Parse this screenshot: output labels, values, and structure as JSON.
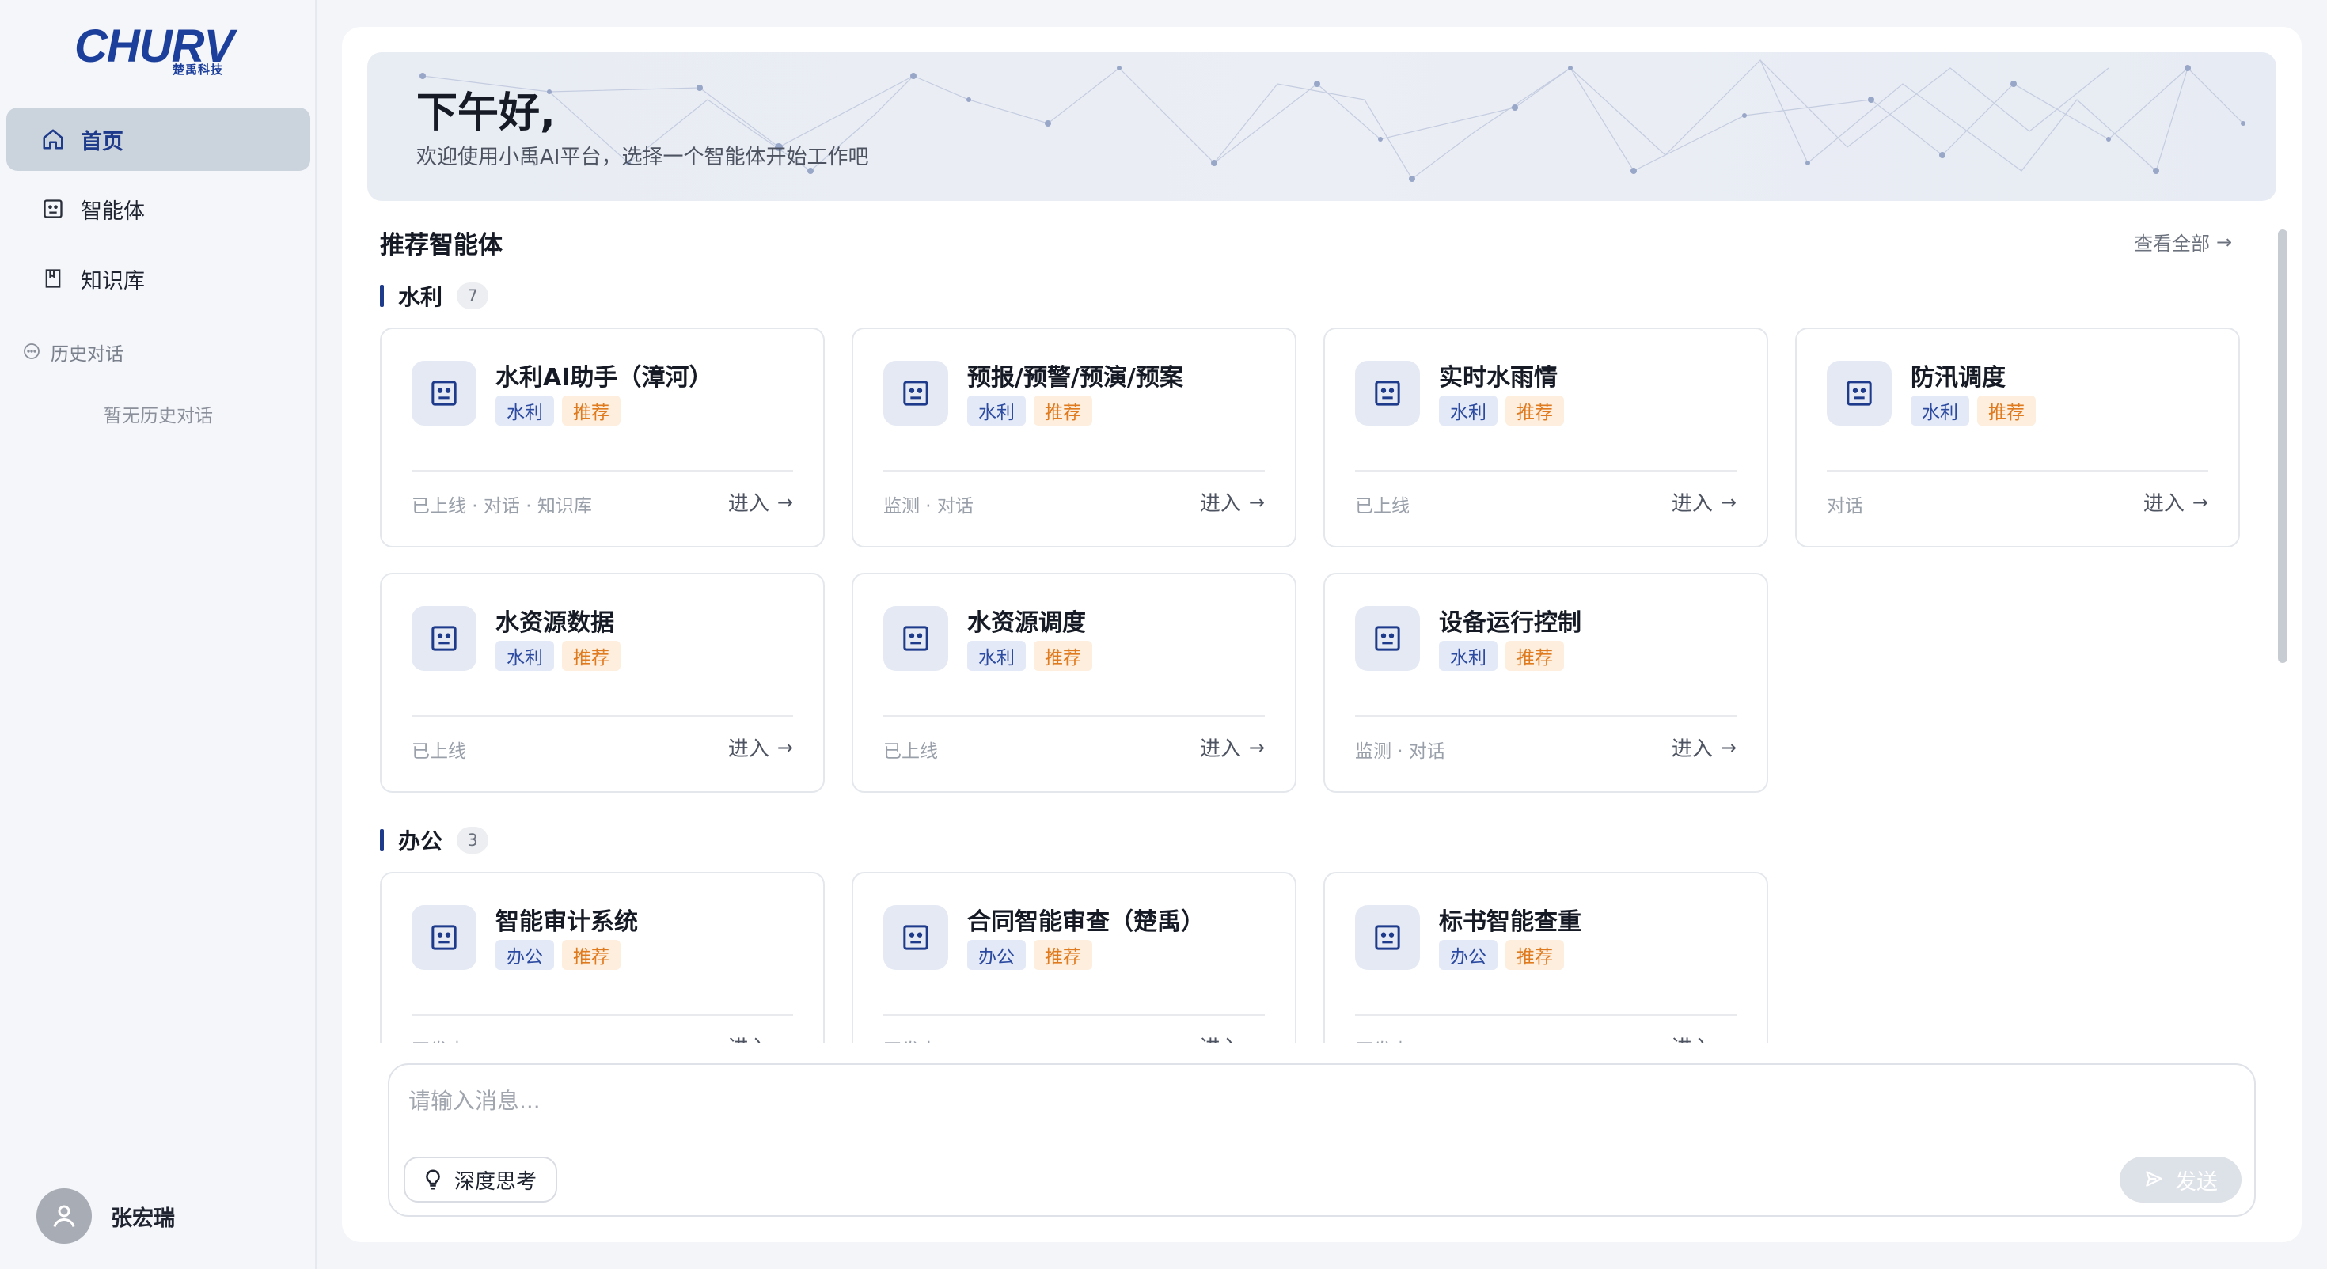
{
  "brand": {
    "logo_text": "CHURV",
    "logo_sub": "楚禹科技"
  },
  "sidebar": {
    "items": [
      {
        "label": "首页",
        "icon": "home-icon",
        "active": true
      },
      {
        "label": "智能体",
        "icon": "robot-icon",
        "active": false
      },
      {
        "label": "知识库",
        "icon": "book-icon",
        "active": false
      }
    ],
    "history_title": "历史对话",
    "history_empty": "暂无历史对话",
    "user_name": "张宏瑞"
  },
  "hero": {
    "greeting": "下午好,",
    "welcome": "欢迎使用小禹AI平台，选择一个智能体开始工作吧"
  },
  "section": {
    "title": "推荐智能体",
    "view_all": "查看全部",
    "enter_label": "进入",
    "recommend_tag": "推荐"
  },
  "categories": [
    {
      "name": "水利",
      "count": "7",
      "cards": [
        {
          "title": "水利AI助手（漳河）",
          "tag": "水利",
          "meta": "已上线 · 对话 · 知识库"
        },
        {
          "title": "预报/预警/预演/预案",
          "tag": "水利",
          "meta": "监测 · 对话"
        },
        {
          "title": "实时水雨情",
          "tag": "水利",
          "meta": "已上线"
        },
        {
          "title": "防汛调度",
          "tag": "水利",
          "meta": "对话"
        },
        {
          "title": "水资源数据",
          "tag": "水利",
          "meta": "已上线"
        },
        {
          "title": "水资源调度",
          "tag": "水利",
          "meta": "已上线"
        },
        {
          "title": "设备运行控制",
          "tag": "水利",
          "meta": "监测 · 对话"
        }
      ]
    },
    {
      "name": "办公",
      "count": "3",
      "cards": [
        {
          "title": "智能审计系统",
          "tag": "办公",
          "meta": "开发中"
        },
        {
          "title": "合同智能审查（楚禹）",
          "tag": "办公",
          "meta": "开发中"
        },
        {
          "title": "标书智能查重",
          "tag": "办公",
          "meta": "开发中"
        }
      ]
    }
  ],
  "chat": {
    "placeholder": "请输入消息...",
    "deep_think": "深度思考",
    "send": "发送"
  },
  "colors": {
    "accent": "#1e3a8a",
    "tag_blue_bg": "#e3e9f6",
    "tag_orange_bg": "#fdeede",
    "tag_orange_text": "#e07a1f"
  }
}
